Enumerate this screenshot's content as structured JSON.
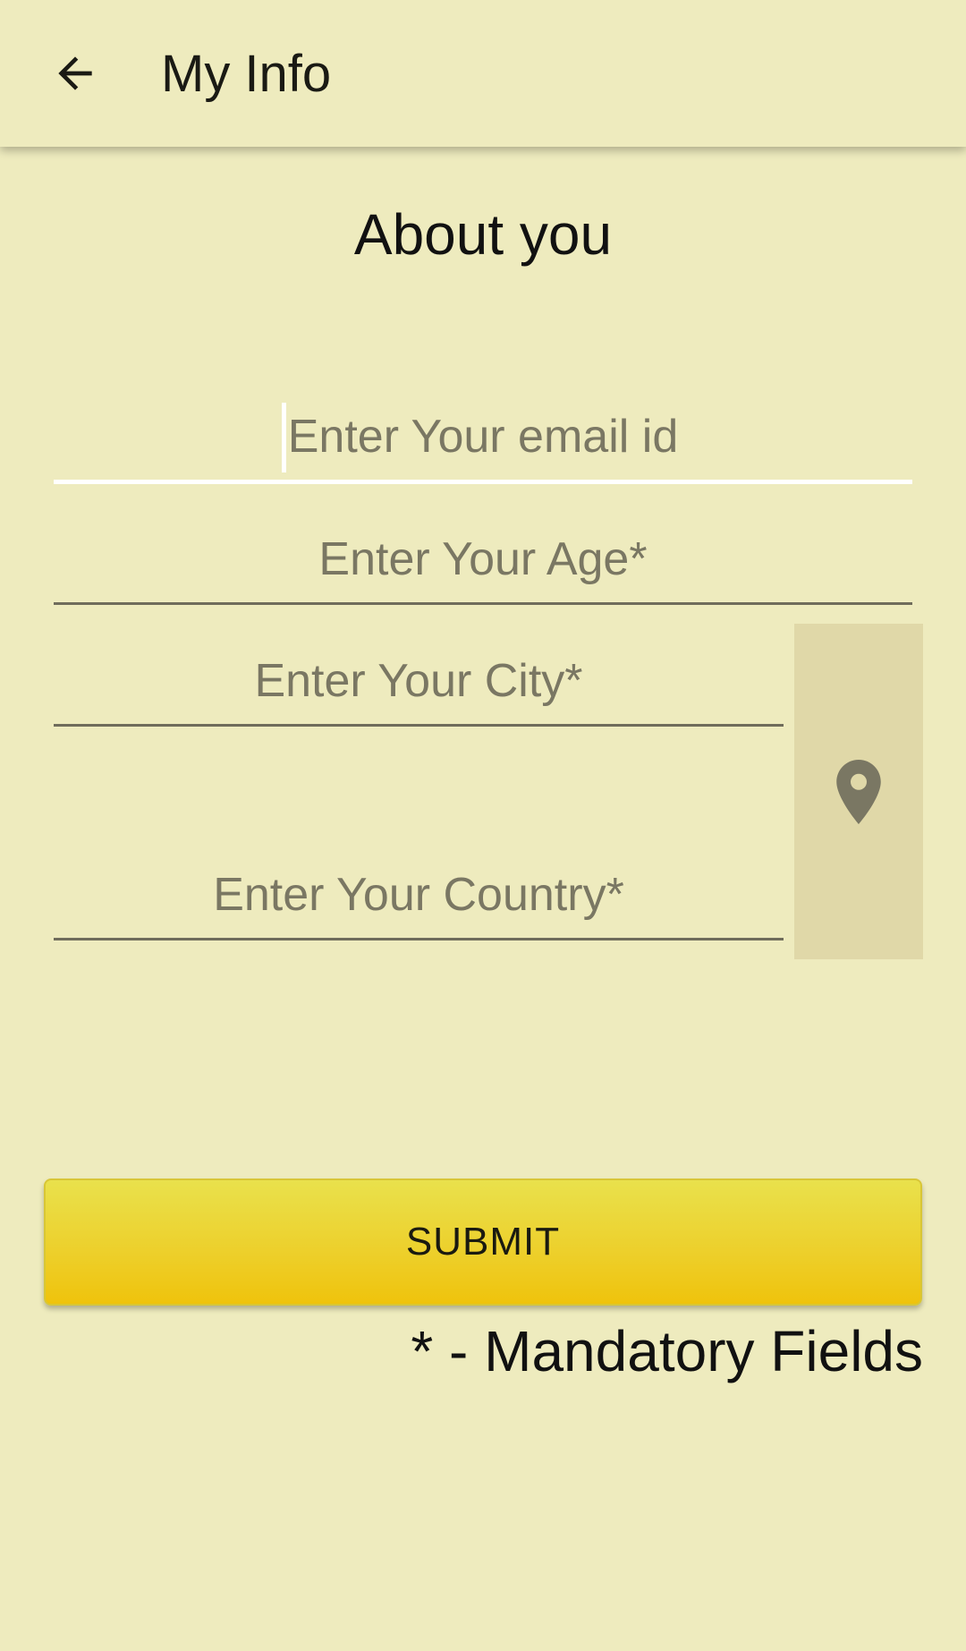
{
  "toolbar": {
    "back_icon": "arrow-left-icon",
    "title": "My Info"
  },
  "form": {
    "section_title": "About you",
    "email": {
      "placeholder": "Enter Your email id",
      "value": ""
    },
    "age": {
      "placeholder": "Enter Your Age*",
      "value": ""
    },
    "city": {
      "placeholder": "Enter Your City*",
      "value": ""
    },
    "country": {
      "placeholder": "Enter Your Country*",
      "value": ""
    },
    "location_icon": "map-pin-icon",
    "submit_label": "SUBMIT",
    "mandatory_note": "* - Mandatory Fields"
  },
  "colors": {
    "background": "#eeebbe",
    "submit_gradient_top": "#e9e14c",
    "submit_gradient_bottom": "#efc30c",
    "location_button": "#e0d8a8",
    "placeholder": "#7a7763"
  }
}
